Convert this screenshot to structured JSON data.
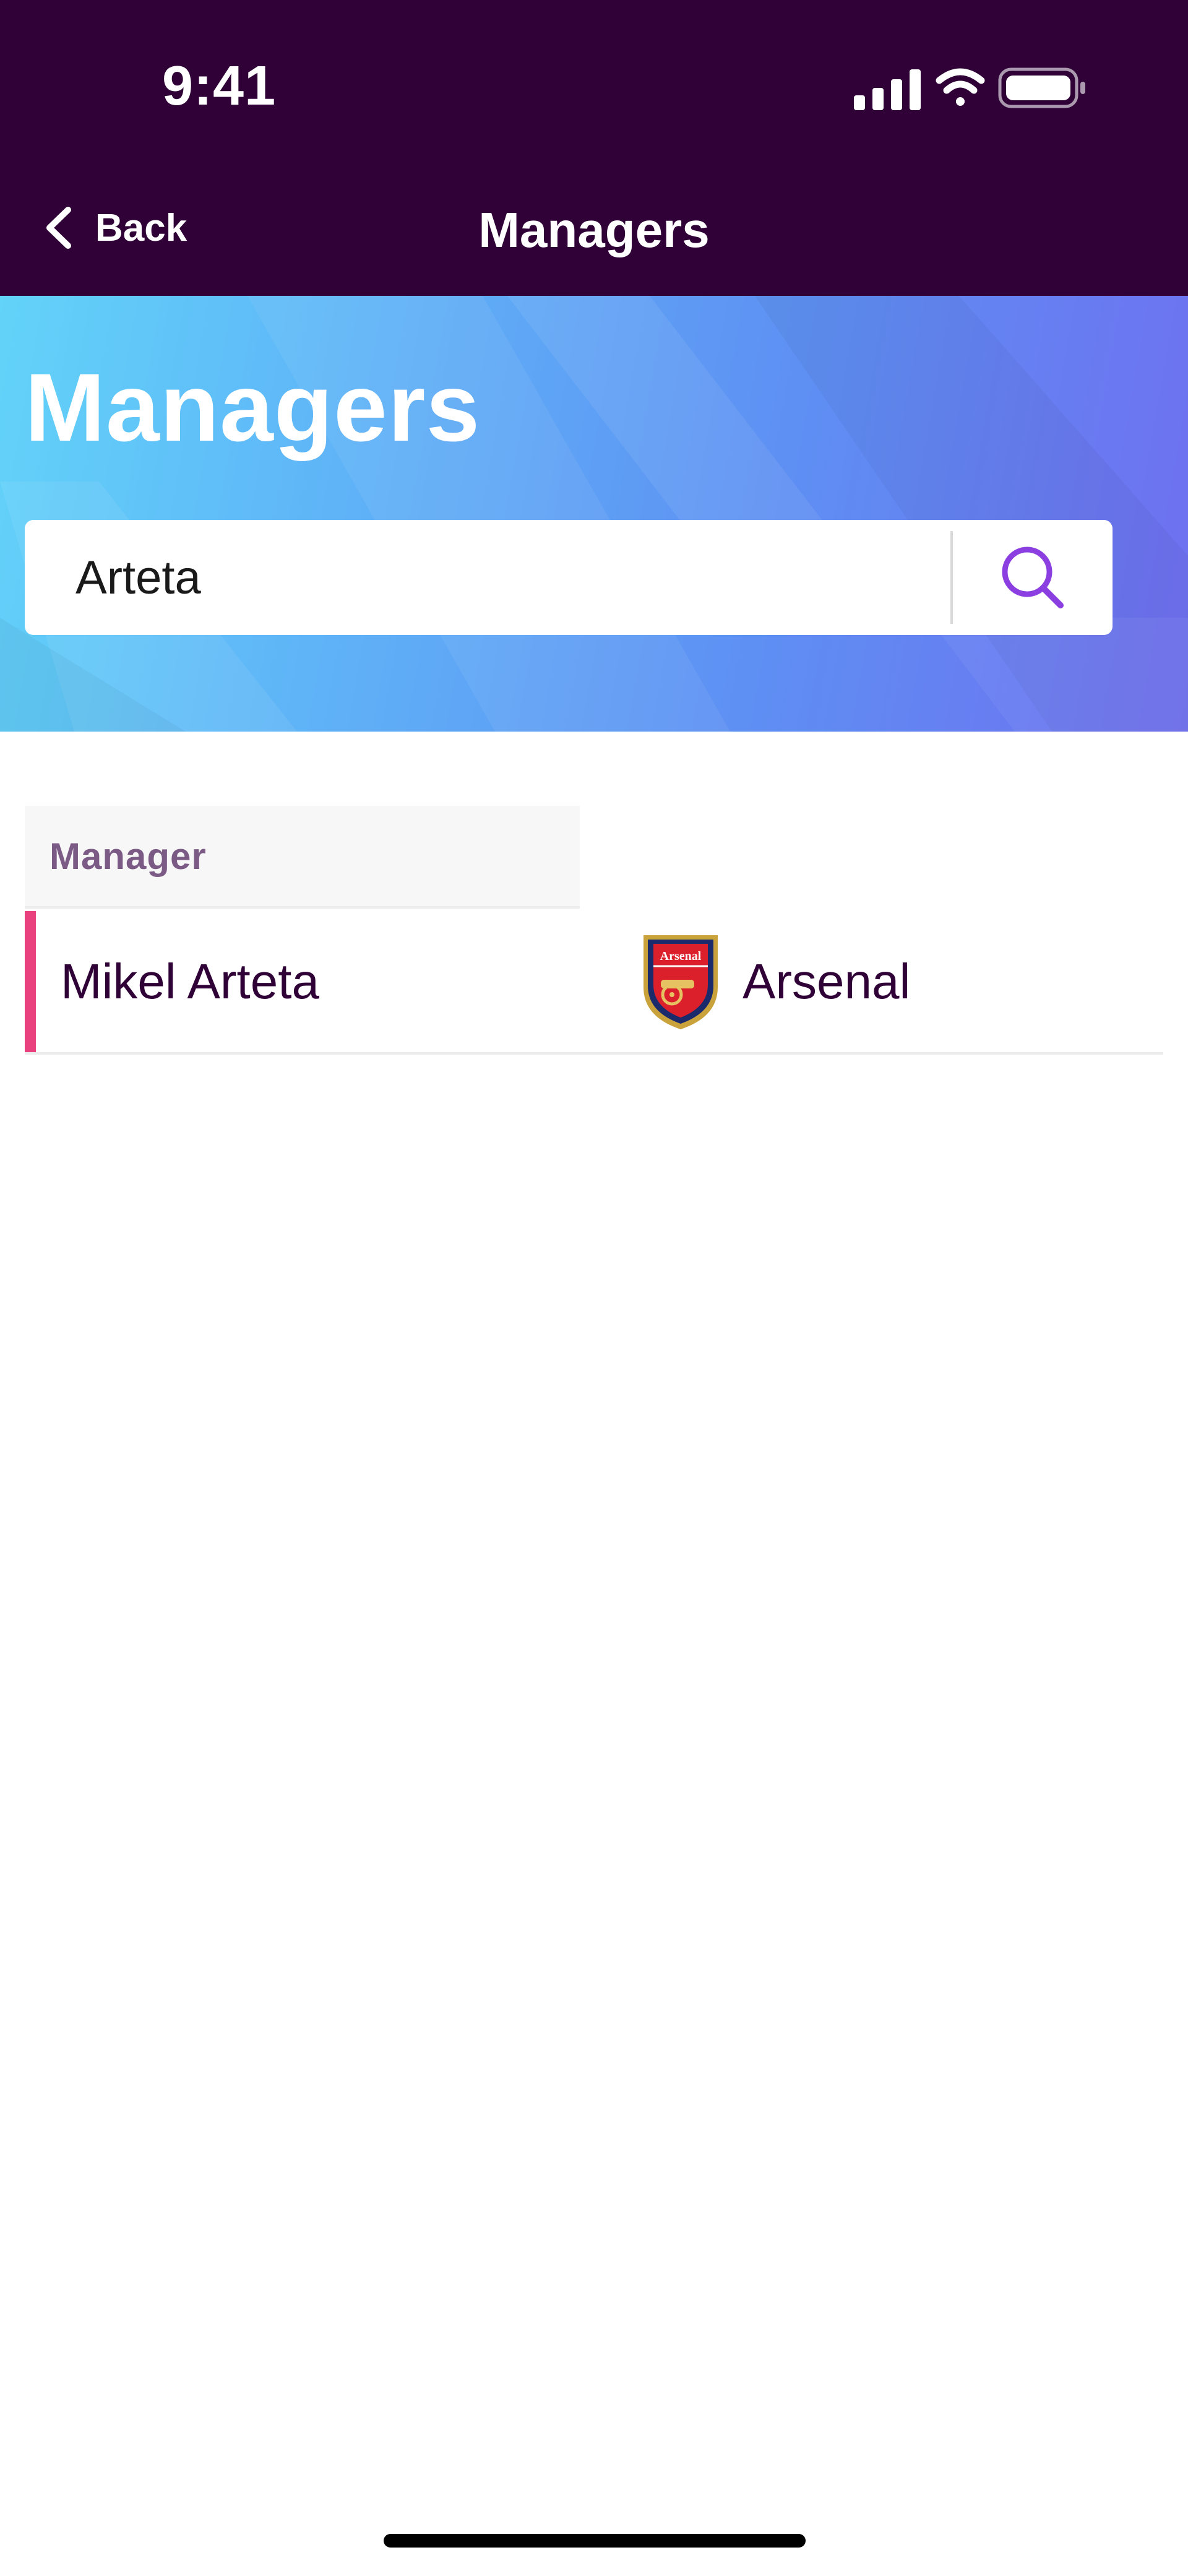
{
  "status_bar": {
    "time": "9:41"
  },
  "nav": {
    "back_label": "Back",
    "title": "Managers"
  },
  "hero": {
    "title": "Managers"
  },
  "search": {
    "value": "Arteta"
  },
  "table": {
    "header": "Manager",
    "rows": [
      {
        "name": "Mikel Arteta",
        "club": "Arsenal",
        "badge_text": "Arsenal"
      }
    ]
  },
  "colors": {
    "nav_background": "#2f0137",
    "accent_pink": "#e9417d",
    "search_icon": "#8b3fe0",
    "header_text": "#7c5a86"
  },
  "icons": {
    "back": "chevron-left-icon",
    "search": "search-icon",
    "signal": "cellular-signal-icon",
    "wifi": "wifi-icon",
    "battery": "battery-icon",
    "club_badge": "arsenal-crest-icon"
  }
}
